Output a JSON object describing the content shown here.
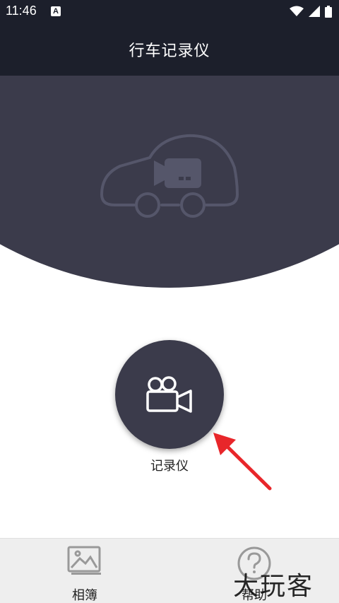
{
  "status_bar": {
    "time": "11:46",
    "notification_icon_letter": "A",
    "icons": [
      "wifi-icon",
      "signal-icon",
      "battery-icon"
    ]
  },
  "header": {
    "title": "行车记录仪"
  },
  "hero": {
    "icon": "car-camera-icon"
  },
  "main": {
    "record_button_icon": "video-camera-icon",
    "record_label": "记录仪"
  },
  "bottom_nav": {
    "items": [
      {
        "label": "相簿",
        "icon": "image-icon"
      },
      {
        "label": "帮助",
        "icon": "help-icon"
      }
    ]
  },
  "watermark": {
    "text": "大玩客"
  },
  "colors": {
    "header_bg": "#1c1f2b",
    "hero_bg": "#3b3b4b",
    "arrow": "#e8262a",
    "nav_bg": "#eeeeee"
  }
}
